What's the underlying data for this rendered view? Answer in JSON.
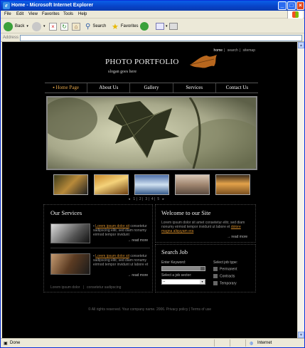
{
  "window": {
    "title": "Home - Microsoft Internet Explorer"
  },
  "menu": [
    "File",
    "Edit",
    "View",
    "Favorites",
    "Tools",
    "Help"
  ],
  "toolbar": {
    "back": "Back",
    "search": "Search",
    "favorites": "Favorites"
  },
  "address": {
    "label": "Address",
    "value": ""
  },
  "status": {
    "left": "Done",
    "zone": "Internet"
  },
  "site": {
    "toplinks": [
      "home",
      "search",
      "sitemap"
    ],
    "logo": "PHOTO PORTFOLIO",
    "slogan": "slogan goes here",
    "nav": [
      "Home Page",
      "About Us",
      "Gallery",
      "Services",
      "Contact Us"
    ],
    "pager": [
      "1",
      "2",
      "3",
      "4",
      "5"
    ],
    "services": {
      "title": "Our Services",
      "item1_link": "Lorem ipsum dolor sit",
      "item1_text": "consetetur sadipscing elitr, sed diam nonumy eirmod tempor invidunt",
      "item1_more": "read more",
      "item2_link": "Lorem ipsum dolor sit",
      "item2_text": "consetetur sadipscing elitr, sed diam nonumy eirmod tempor invidunt ut labore et",
      "item2_more": "read more",
      "foot_a": "Lorem ipsum dolor",
      "foot_b": "consetetur sadipscing"
    },
    "welcome": {
      "title": "Welcome to our Site",
      "text": "Lorem ipsum dolor sit amet consetetur elitr, sed diam nonumy eirmod tempor invidunt ut labore et",
      "link": "dolore magna aliquyam era",
      "more": "read more"
    },
    "search": {
      "title": "Search Job",
      "keyword_label": "Enter Keyword:",
      "sector_label": "Select a job sector:",
      "sector_value": "--",
      "type_label": "Select job type:",
      "types": [
        "Permanent",
        "Contracts",
        "Temporary"
      ]
    },
    "footer": "© All rights reserved. Your company name. 2006. Privacy policy | Terms of use"
  }
}
